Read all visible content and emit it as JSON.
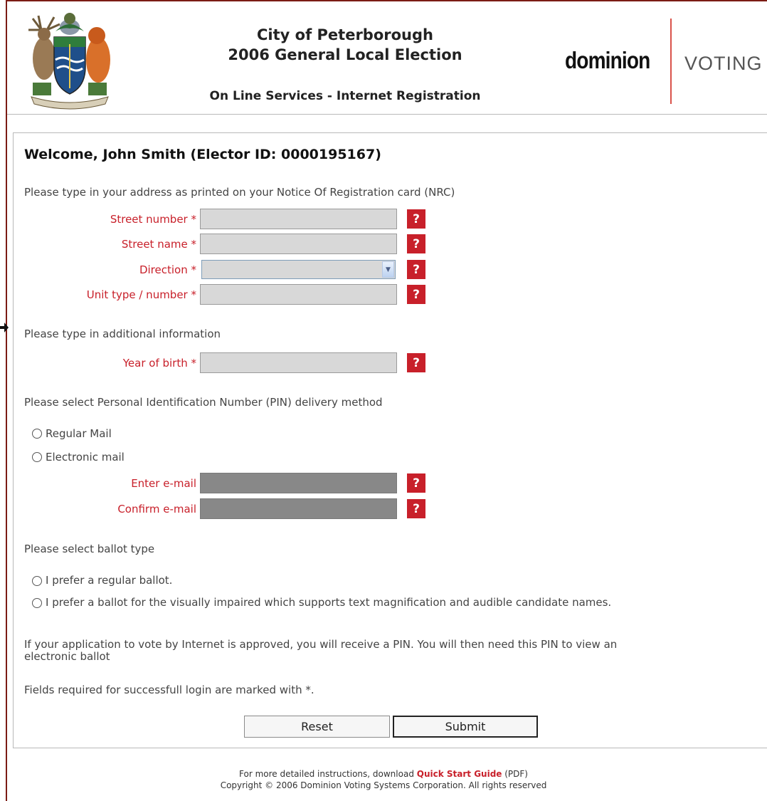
{
  "header": {
    "city": "City of Peterborough",
    "election": "2006 General Local Election",
    "service": "On Line Services - Internet Registration",
    "logo_left": "dominion",
    "logo_right": "VOTING",
    "logo_tm": "™"
  },
  "welcome": "Welcome, John Smith (Elector ID: 0000195167)",
  "address_section": {
    "intro": "Please type in your address as printed on your Notice Of Registration card (NRC)",
    "street_number_label": "Street number *",
    "street_name_label": "Street name *",
    "direction_label": "Direction *",
    "unit_label": "Unit type / number *",
    "street_number_value": "",
    "street_name_value": "",
    "direction_value": "",
    "unit_value": ""
  },
  "additional_section": {
    "intro": "Please type in additional information",
    "birth_label": "Year of birth *",
    "birth_value": ""
  },
  "pin_section": {
    "intro": "Please select Personal Identification Number (PIN) delivery method",
    "option_mail": "Regular Mail",
    "option_email": "Electronic mail",
    "enter_email_label": "Enter e-mail",
    "confirm_email_label": "Confirm e-mail"
  },
  "ballot_section": {
    "intro": "Please select ballot type",
    "option_regular": "I prefer a regular ballot.",
    "option_impaired": "I prefer a ballot for the visually impaired which supports text magnification and audible candidate names."
  },
  "info_line1": "If your application to vote by Internet is approved, you will receive a PIN. You will then need this PIN to view an",
  "info_line2": "electronic ballot",
  "required_note": "Fields required for successfull login are marked with *.",
  "help_glyph": "?",
  "buttons": {
    "reset": "Reset",
    "submit": "Submit"
  },
  "footer": {
    "prefix": "For more detailed instructions, download ",
    "link": "Quick Start Guide",
    "suffix": " (PDF)",
    "copyright": "Copyright © 2006 Dominion Voting Systems Corporation. All rights reserved"
  },
  "colors": {
    "accent": "#c8202a",
    "border": "#7b1b14"
  }
}
